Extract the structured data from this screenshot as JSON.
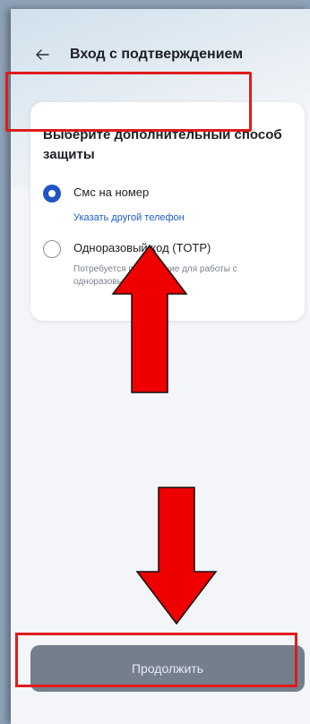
{
  "header": {
    "title": "Вход с подтверждением",
    "back_icon": "arrow-left-icon"
  },
  "card": {
    "title": "Выберите дополнительный способ защиты",
    "options": [
      {
        "label": "Смс на номер",
        "link": "Указать другой телефон",
        "selected": true
      },
      {
        "label": "Одноразовый код (TOTP)",
        "description": "Потребуется приложение для работы с одноразовыми кодами",
        "selected": false
      }
    ]
  },
  "continue_button": {
    "label": "Продолжить",
    "enabled": false
  },
  "annotations": {
    "highlight_color": "#e01c1c",
    "arrow_icons": [
      "arrow-up-icon",
      "arrow-down-icon"
    ]
  },
  "colors": {
    "accent": "#1f55c6",
    "link": "#1e5bc7",
    "button_disabled": "#747e8d"
  }
}
